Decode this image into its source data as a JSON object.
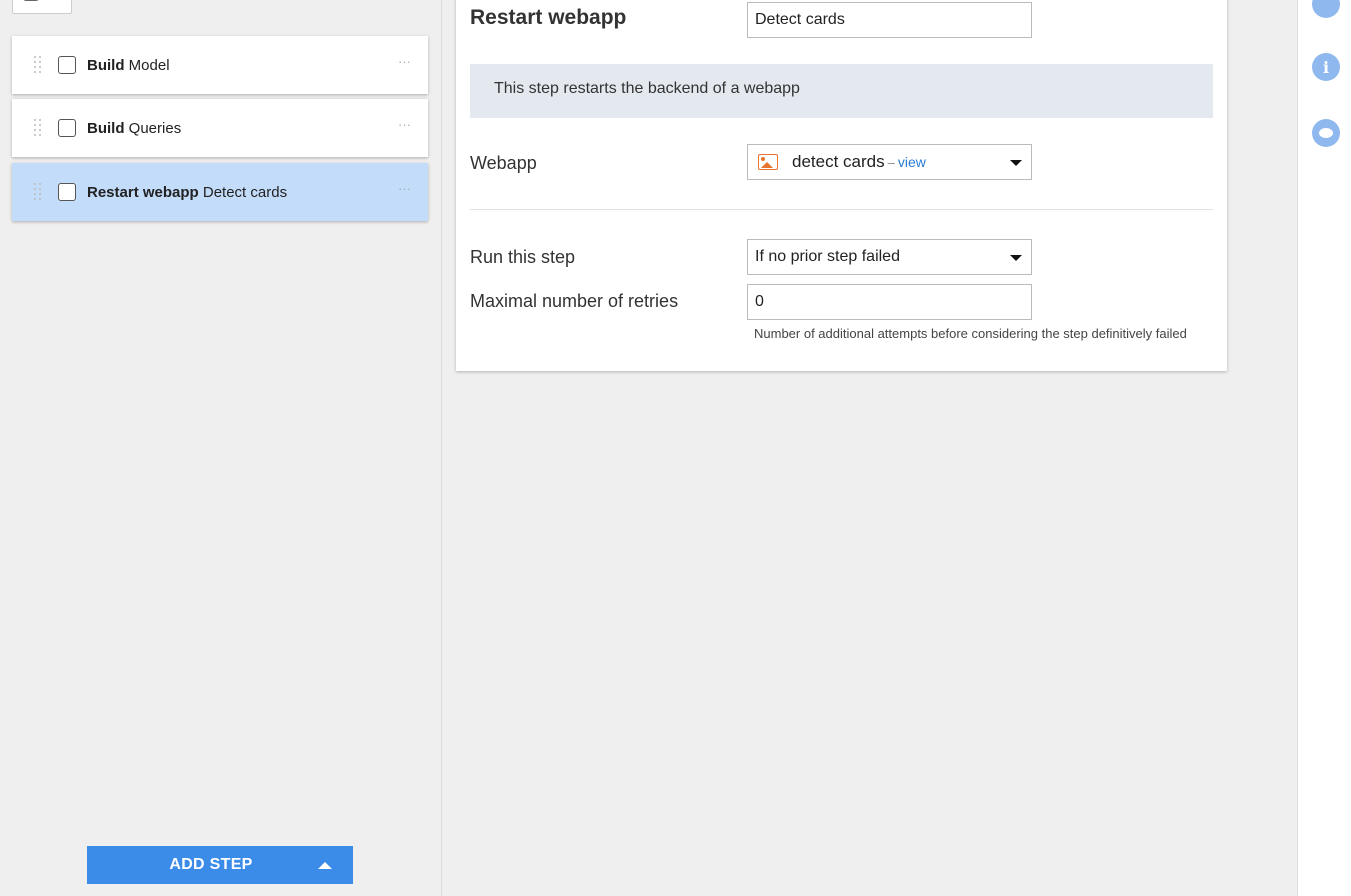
{
  "steps": [
    {
      "type": "Build",
      "name": "Model",
      "selected": false
    },
    {
      "type": "Build",
      "name": "Queries",
      "selected": false
    },
    {
      "type": "Restart webapp",
      "name": "Detect cards",
      "selected": true
    }
  ],
  "step_menu_glyph": "···",
  "add_step_label": "ADD STEP",
  "detail": {
    "step_type": "Restart webapp",
    "step_name_value": "Detect cards",
    "info_text": "This step restarts the backend of a webapp",
    "webapp_label": "Webapp",
    "webapp_value": "detect cards",
    "webapp_dash": "–",
    "webapp_view_link": "view",
    "run_label": "Run this step",
    "run_value": "If no prior step failed",
    "retries_label": "Maximal number of retries",
    "retries_value": "0",
    "retries_help": "Number of additional attempts before considering the step definitively failed"
  },
  "rail": {
    "info_icon_glyph": "i"
  },
  "colors": {
    "accent": "#3b8ce9",
    "selected_row": "#c2dcfa",
    "webapp_icon": "#e8732a",
    "link": "#2a7bd5"
  },
  "icons": [
    "drag-handle-icon",
    "more-icon",
    "caret-up-icon",
    "image-icon",
    "dropdown-caret-icon",
    "add-icon",
    "info-icon",
    "chat-icon"
  ]
}
